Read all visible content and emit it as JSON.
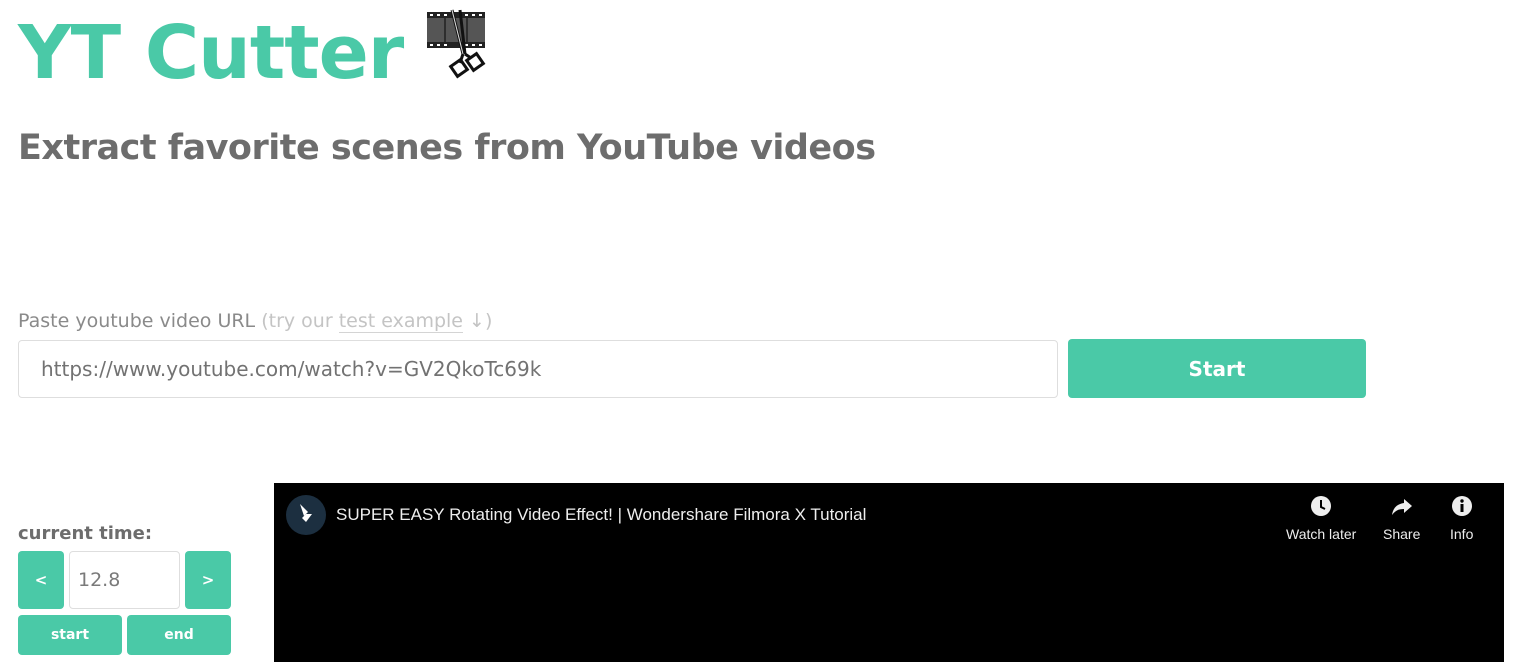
{
  "header": {
    "title": "YT Cutter",
    "logo_icon": "film-scissors-icon",
    "subtitle": "Extract favorite scenes from YouTube videos"
  },
  "url_form": {
    "label": "Paste youtube video URL",
    "hint_prefix": "(try our ",
    "hint_link": "test example",
    "hint_arrow": "↓",
    "hint_suffix": ")",
    "input_value": "https://www.youtube.com/watch?v=GV2QkoTc69k",
    "start_label": "Start"
  },
  "time_controls": {
    "label": "current time:",
    "prev_label": "<",
    "next_label": ">",
    "time_value": "12.8",
    "set_start_label": "start",
    "set_end_label": "end"
  },
  "player": {
    "video_title": "SUPER EASY Rotating Video Effect! | Wondershare Filmora X Tutorial",
    "channel_icon": "filmora-logo-icon",
    "actions": [
      {
        "label": "Watch later",
        "icon": "clock-icon"
      },
      {
        "label": "Share",
        "icon": "share-arrow-icon"
      },
      {
        "label": "Info",
        "icon": "info-icon"
      }
    ]
  },
  "colors": {
    "accent": "#4ac9a7",
    "heading_gray": "#6d6d6d",
    "player_bg": "#000000"
  }
}
